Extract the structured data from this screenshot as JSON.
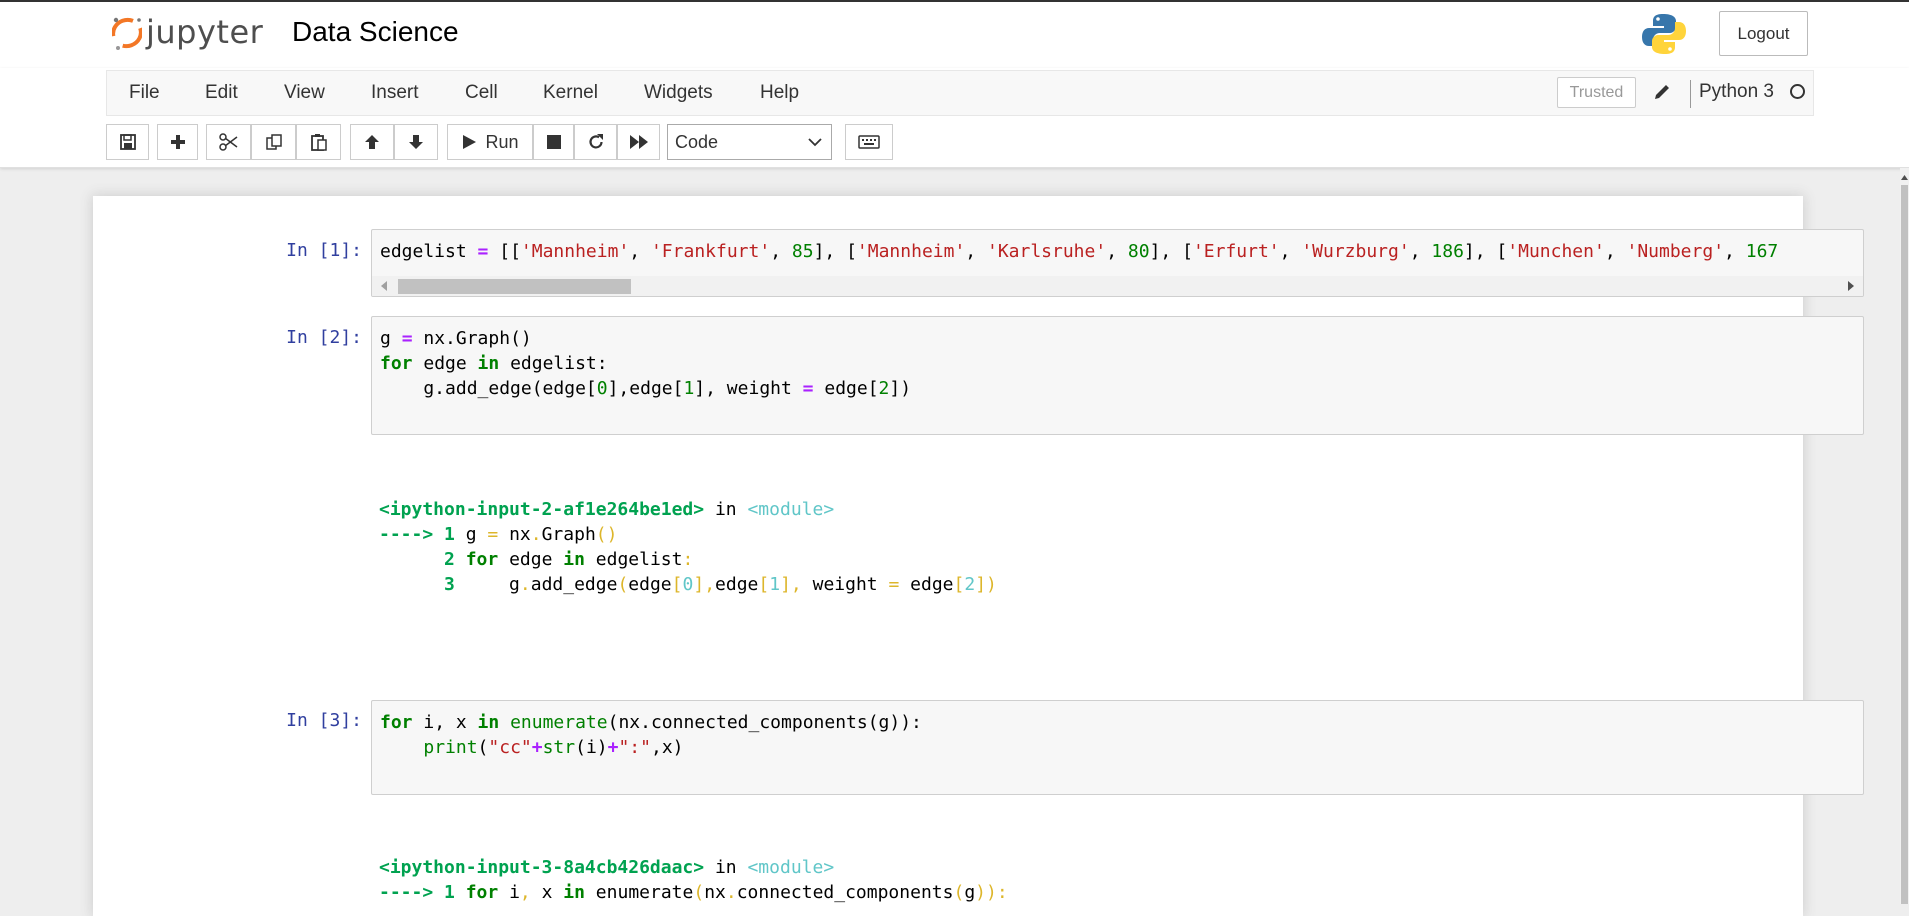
{
  "app": {
    "logo_text": "jupyter",
    "notebook_title": "Data Science",
    "logout_label": "Logout"
  },
  "menu": {
    "items": [
      "File",
      "Edit",
      "View",
      "Insert",
      "Cell",
      "Kernel",
      "Widgets",
      "Help"
    ],
    "trusted_label": "Trusted",
    "kernel_name": "Python 3"
  },
  "toolbar": {
    "run_label": "Run",
    "cell_type": "Code",
    "icons": [
      "save-icon",
      "plus-icon",
      "cut-icon",
      "copy-icon",
      "paste-icon",
      "arrow-up-icon",
      "arrow-down-icon",
      "play-icon",
      "stop-icon",
      "restart-icon",
      "fast-forward-icon",
      "keyboard-icon"
    ]
  },
  "cells": [
    {
      "prompt": "In [1]:",
      "lines": [
        "edgelist = [['Mannheim', 'Frankfurt', 85], ['Mannheim', 'Karlsruhe', 80], ['Erfurt', 'Wurzburg', 186], ['Munchen', 'Numberg', 167"
      ]
    },
    {
      "prompt": "In [2]:",
      "lines": [
        "g = nx.Graph()",
        "for edge in edgelist:",
        "    g.add_edge(edge[0],edge[1], weight = edge[2])"
      ],
      "output": [
        "<ipython-input-2-af1e264be1ed> in <module>",
        "----> 1 g = nx.Graph()",
        "      2 for edge in edgelist:",
        "      3     g.add_edge(edge[0],edge[1], weight = edge[2])"
      ]
    },
    {
      "prompt": "In [3]:",
      "lines": [
        "for i, x in enumerate(nx.connected_components(g)):",
        "    print(\"cc\"+str(i)+\":\",x)"
      ],
      "output": [
        "<ipython-input-3-8a4cb426daac> in <module>",
        "----> 1 for i, x in enumerate(nx.connected_components(g)):"
      ]
    }
  ],
  "colors": {
    "keyword": "#008000",
    "string": "#ba2121",
    "operator": "#aa22ff",
    "prompt": "#303f9f",
    "traceback_green": "#00a250",
    "traceback_cyan": "#60c6c8",
    "traceback_yellow": "#ddb62b"
  }
}
